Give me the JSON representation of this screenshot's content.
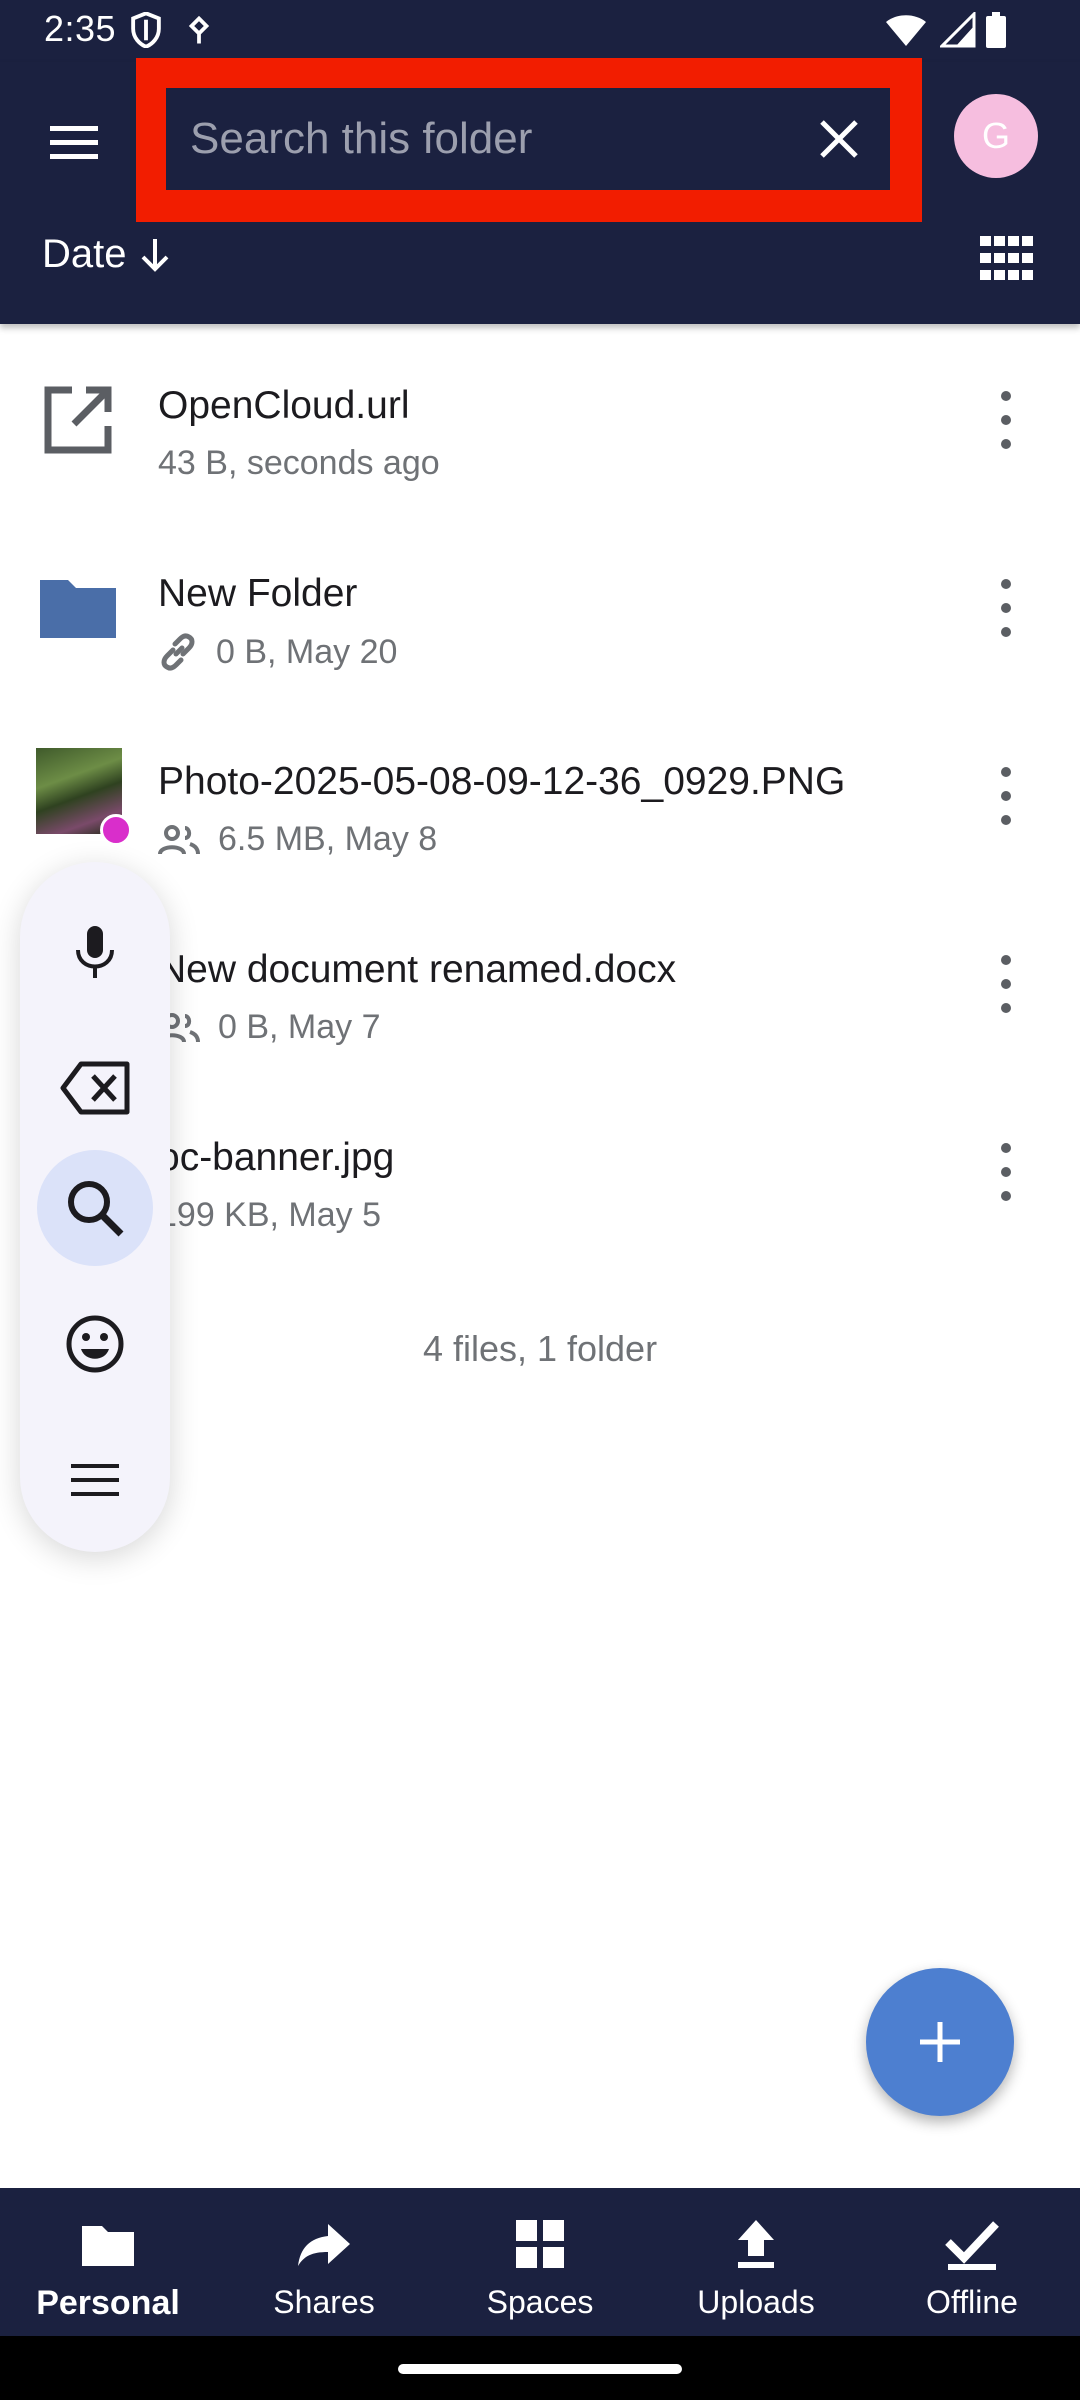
{
  "status_bar": {
    "time": "2:35",
    "icons": [
      "shield-icon",
      "network-icon",
      "wifi-icon",
      "signal-icon",
      "battery-icon"
    ]
  },
  "app_bar": {
    "search": {
      "placeholder": "Search this folder",
      "value": ""
    },
    "avatar_letter": "G",
    "sort_label": "Date",
    "colors": {
      "bar": "#1b2140",
      "highlight": "#f21d00",
      "avatar": "#f6bedf"
    }
  },
  "files": [
    {
      "name": "OpenCloud.url",
      "meta": "43 B, seconds ago",
      "icon": "external-link-icon"
    },
    {
      "name": "New Folder",
      "meta": "0 B, May 20",
      "icon": "folder-icon",
      "badge": "link-icon"
    },
    {
      "name": "Photo-2025-05-08-09-12-36_0929.PNG",
      "meta": "6.5 MB, May 8",
      "icon": "image-thumbnail",
      "badge": "shared-icon"
    },
    {
      "name": "New document renamed.docx",
      "meta": "0 B, May 7",
      "icon": "document-icon",
      "badge": "shared-icon"
    },
    {
      "name": "oc-banner.jpg",
      "meta": "199 KB, May 5",
      "icon": "image-icon"
    }
  ],
  "footer_count": "4 files, 1 folder",
  "keyboard_panel": [
    "microphone-icon",
    "backspace-icon",
    "search-icon",
    "emoji-icon",
    "menu-icon"
  ],
  "bottom_nav": [
    {
      "label": "Personal",
      "icon": "folder-icon",
      "active": true
    },
    {
      "label": "Shares",
      "icon": "share-icon",
      "active": false
    },
    {
      "label": "Spaces",
      "icon": "spaces-grid-icon",
      "active": false
    },
    {
      "label": "Uploads",
      "icon": "upload-icon",
      "active": false
    },
    {
      "label": "Offline",
      "icon": "check-icon",
      "active": false
    }
  ]
}
